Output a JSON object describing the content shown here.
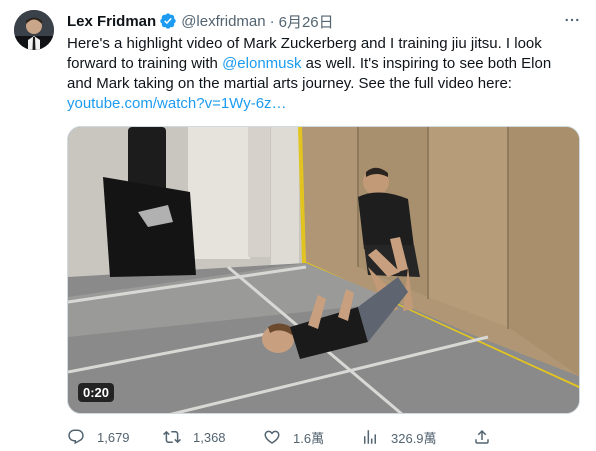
{
  "author": {
    "name": "Lex Fridman",
    "handle": "@lexfridman",
    "separator": "·",
    "date": "6月26日",
    "verified": true
  },
  "tweet": {
    "text_part1": "Here's a highlight video of Mark Zuckerberg and I training jiu jitsu. I look forward to training with ",
    "mention": "@elonmusk",
    "text_part2": " as well. It's inspiring to see both Elon and Mark taking on the martial arts journey. See the full video here:",
    "link": "youtube.com/watch?v=1Wy-6z…"
  },
  "media": {
    "type": "video",
    "duration": "0:20"
  },
  "actions": {
    "replies": "1,679",
    "retweets": "1,368",
    "likes": "1.6萬",
    "views": "326.9萬"
  },
  "icons": {
    "verified": "verified-badge-icon",
    "more": "more-options-icon",
    "reply": "reply-icon",
    "retweet": "retweet-icon",
    "like": "heart-icon",
    "views": "views-chart-icon",
    "share": "share-icon"
  },
  "colors": {
    "accent": "#1d9bf0",
    "secondary_text": "#536471",
    "primary_text": "#0f1419"
  }
}
